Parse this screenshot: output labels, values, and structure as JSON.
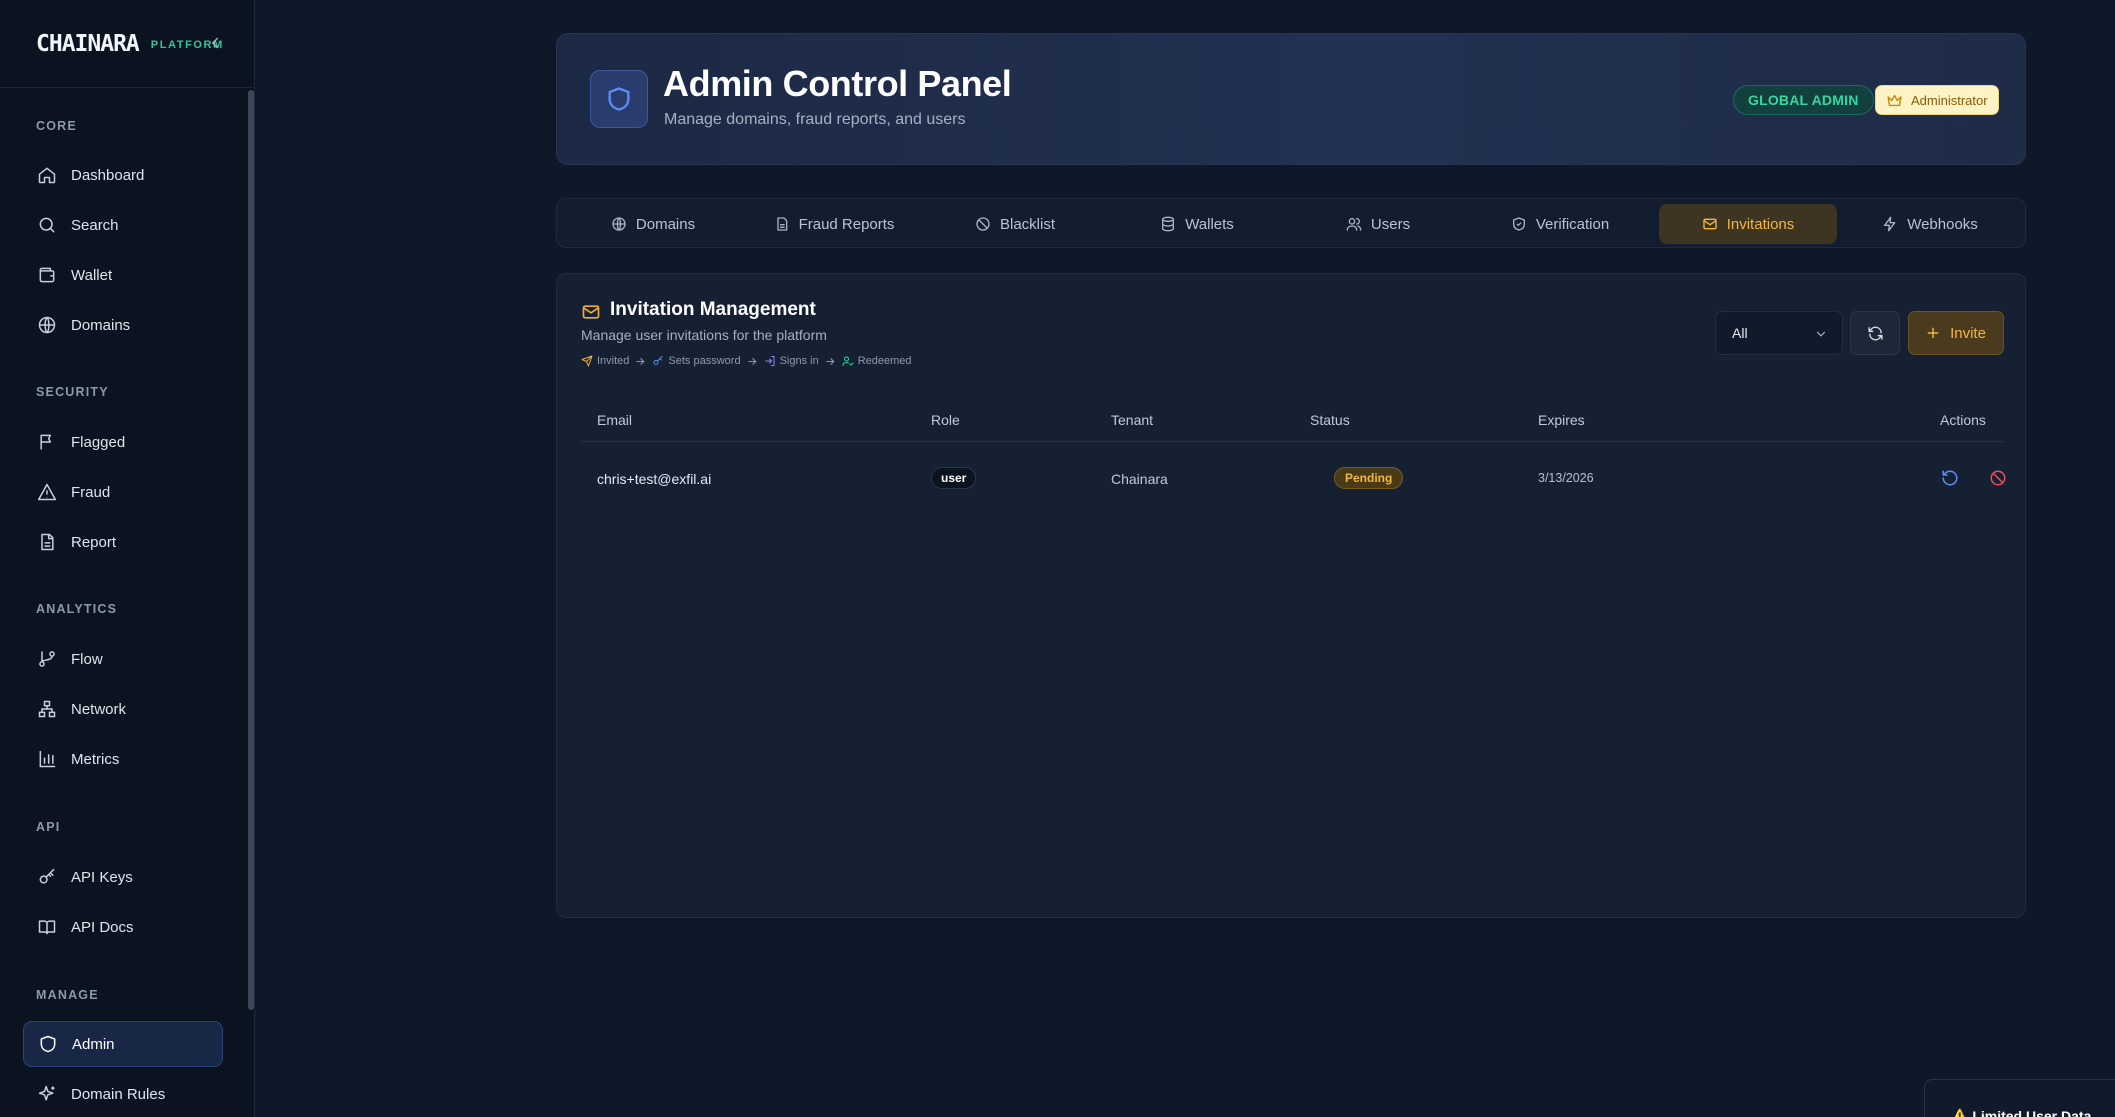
{
  "brand": {
    "name": "CHAINARA",
    "tag": "PLATFORM"
  },
  "sidebar": {
    "sections": [
      {
        "label": "CORE",
        "items": [
          {
            "label": "Dashboard",
            "icon": "home-icon"
          },
          {
            "label": "Search",
            "icon": "search-icon"
          },
          {
            "label": "Wallet",
            "icon": "wallet-icon"
          },
          {
            "label": "Domains",
            "icon": "globe-icon"
          }
        ]
      },
      {
        "label": "SECURITY",
        "items": [
          {
            "label": "Flagged",
            "icon": "flag-icon"
          },
          {
            "label": "Fraud",
            "icon": "warning-icon"
          },
          {
            "label": "Report",
            "icon": "document-icon"
          }
        ]
      },
      {
        "label": "ANALYTICS",
        "items": [
          {
            "label": "Flow",
            "icon": "git-branch-icon"
          },
          {
            "label": "Network",
            "icon": "network-icon"
          },
          {
            "label": "Metrics",
            "icon": "bar-chart-icon"
          }
        ]
      },
      {
        "label": "API",
        "items": [
          {
            "label": "API Keys",
            "icon": "key-icon"
          },
          {
            "label": "API Docs",
            "icon": "book-icon"
          }
        ]
      },
      {
        "label": "MANAGE",
        "items": [
          {
            "label": "Admin",
            "icon": "shield-icon",
            "active": true
          },
          {
            "label": "Domain Rules",
            "icon": "sparkles-icon"
          }
        ]
      }
    ]
  },
  "header": {
    "title": "Admin Control Panel",
    "subtitle": "Manage domains, fraud reports, and users",
    "role_badge": "GLOBAL ADMIN",
    "user_badge": "Administrator"
  },
  "tabs": [
    {
      "label": "Domains",
      "icon": "globe-icon"
    },
    {
      "label": "Fraud Reports",
      "icon": "document-icon"
    },
    {
      "label": "Blacklist",
      "icon": "ban-icon"
    },
    {
      "label": "Wallets",
      "icon": "database-icon"
    },
    {
      "label": "Users",
      "icon": "users-icon"
    },
    {
      "label": "Verification",
      "icon": "shield-check-icon"
    },
    {
      "label": "Invitations",
      "icon": "mail-icon",
      "active": true
    },
    {
      "label": "Webhooks",
      "icon": "zap-icon"
    }
  ],
  "invitations": {
    "title": "Invitation Management",
    "subtitle": "Manage user invitations for the platform",
    "flow": [
      "Invited",
      "Sets password",
      "Signs in",
      "Redeemed"
    ],
    "filter_value": "All",
    "invite_label": "Invite",
    "columns": [
      "Email",
      "Role",
      "Tenant",
      "Status",
      "Expires",
      "Actions"
    ],
    "rows": [
      {
        "email": "chris+test@exfil.ai",
        "role": "user",
        "tenant": "Chainara",
        "status": "Pending",
        "expires": "3/13/2026"
      }
    ]
  },
  "toast": {
    "text": "⚠️ Limited User Data"
  },
  "colors": {
    "accent": "#f4b63c",
    "brand_green": "#33c49a",
    "active_nav": "#172745"
  }
}
